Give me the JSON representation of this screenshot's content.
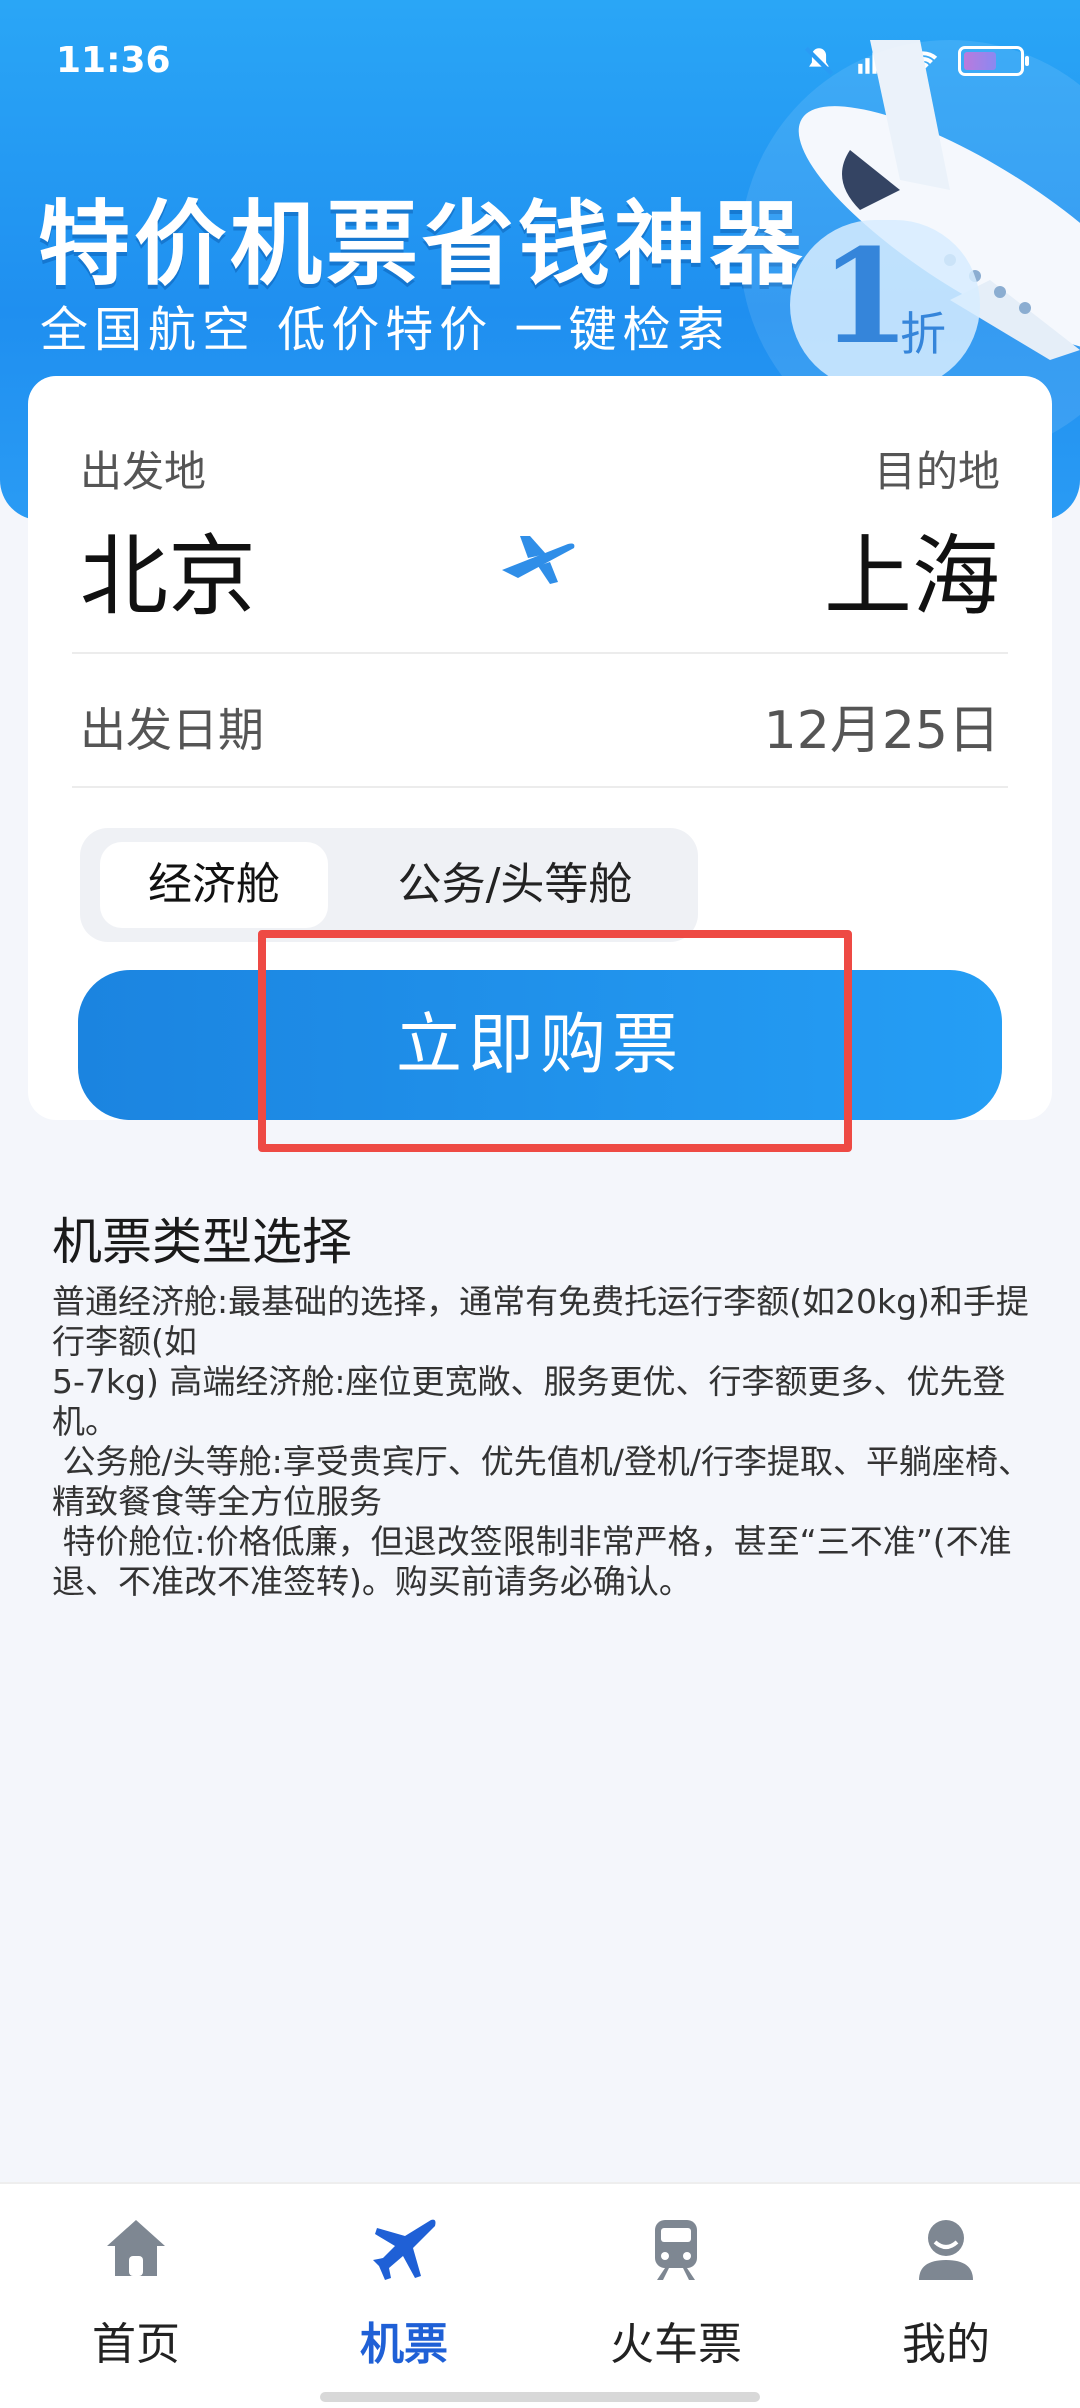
{
  "status_bar": {
    "time": "11:36"
  },
  "banner": {
    "title": "特价机票省钱神器",
    "subtitle": "全国航空  低价特价  一键检索",
    "discount_number": "1",
    "discount_unit": "折"
  },
  "search": {
    "from_label": "出发地",
    "from_value": "北京",
    "to_label": "目的地",
    "to_value": "上海",
    "date_label": "出发日期",
    "date_value": "12月25日",
    "cabin_options": [
      "经济舱",
      "公务/头等舱"
    ],
    "selected_cabin": "经济舱",
    "buy_button": "立即购票"
  },
  "info": {
    "title": "机票类型选择",
    "body": "普通经济舱:最基础的选择，通常有免费托运行李额(如20kg)和手提行李额(如\n5-7kg) 高端经济舱:座位更宽敞、服务更优、行李额更多、优先登机。\n 公务舱/头等舱:享受贵宾厅、优先值机/登机/行李提取、平躺座椅、精致餐食等全方位服务\n 特价舱位:价格低廉，但退改签限制非常严格，甚至“三不准”(不准退、不准改不准签转)。购买前请务必确认。"
  },
  "nav": {
    "items": [
      {
        "label": "首页",
        "icon": "home-icon"
      },
      {
        "label": "机票",
        "icon": "airplane-icon"
      },
      {
        "label": "火车票",
        "icon": "train-icon"
      },
      {
        "label": "我的",
        "icon": "user-icon"
      }
    ],
    "active": "机票"
  },
  "colors": {
    "primary": "#1f8ff0",
    "active_nav": "#1f60d6",
    "highlight": "#ee4a44"
  }
}
